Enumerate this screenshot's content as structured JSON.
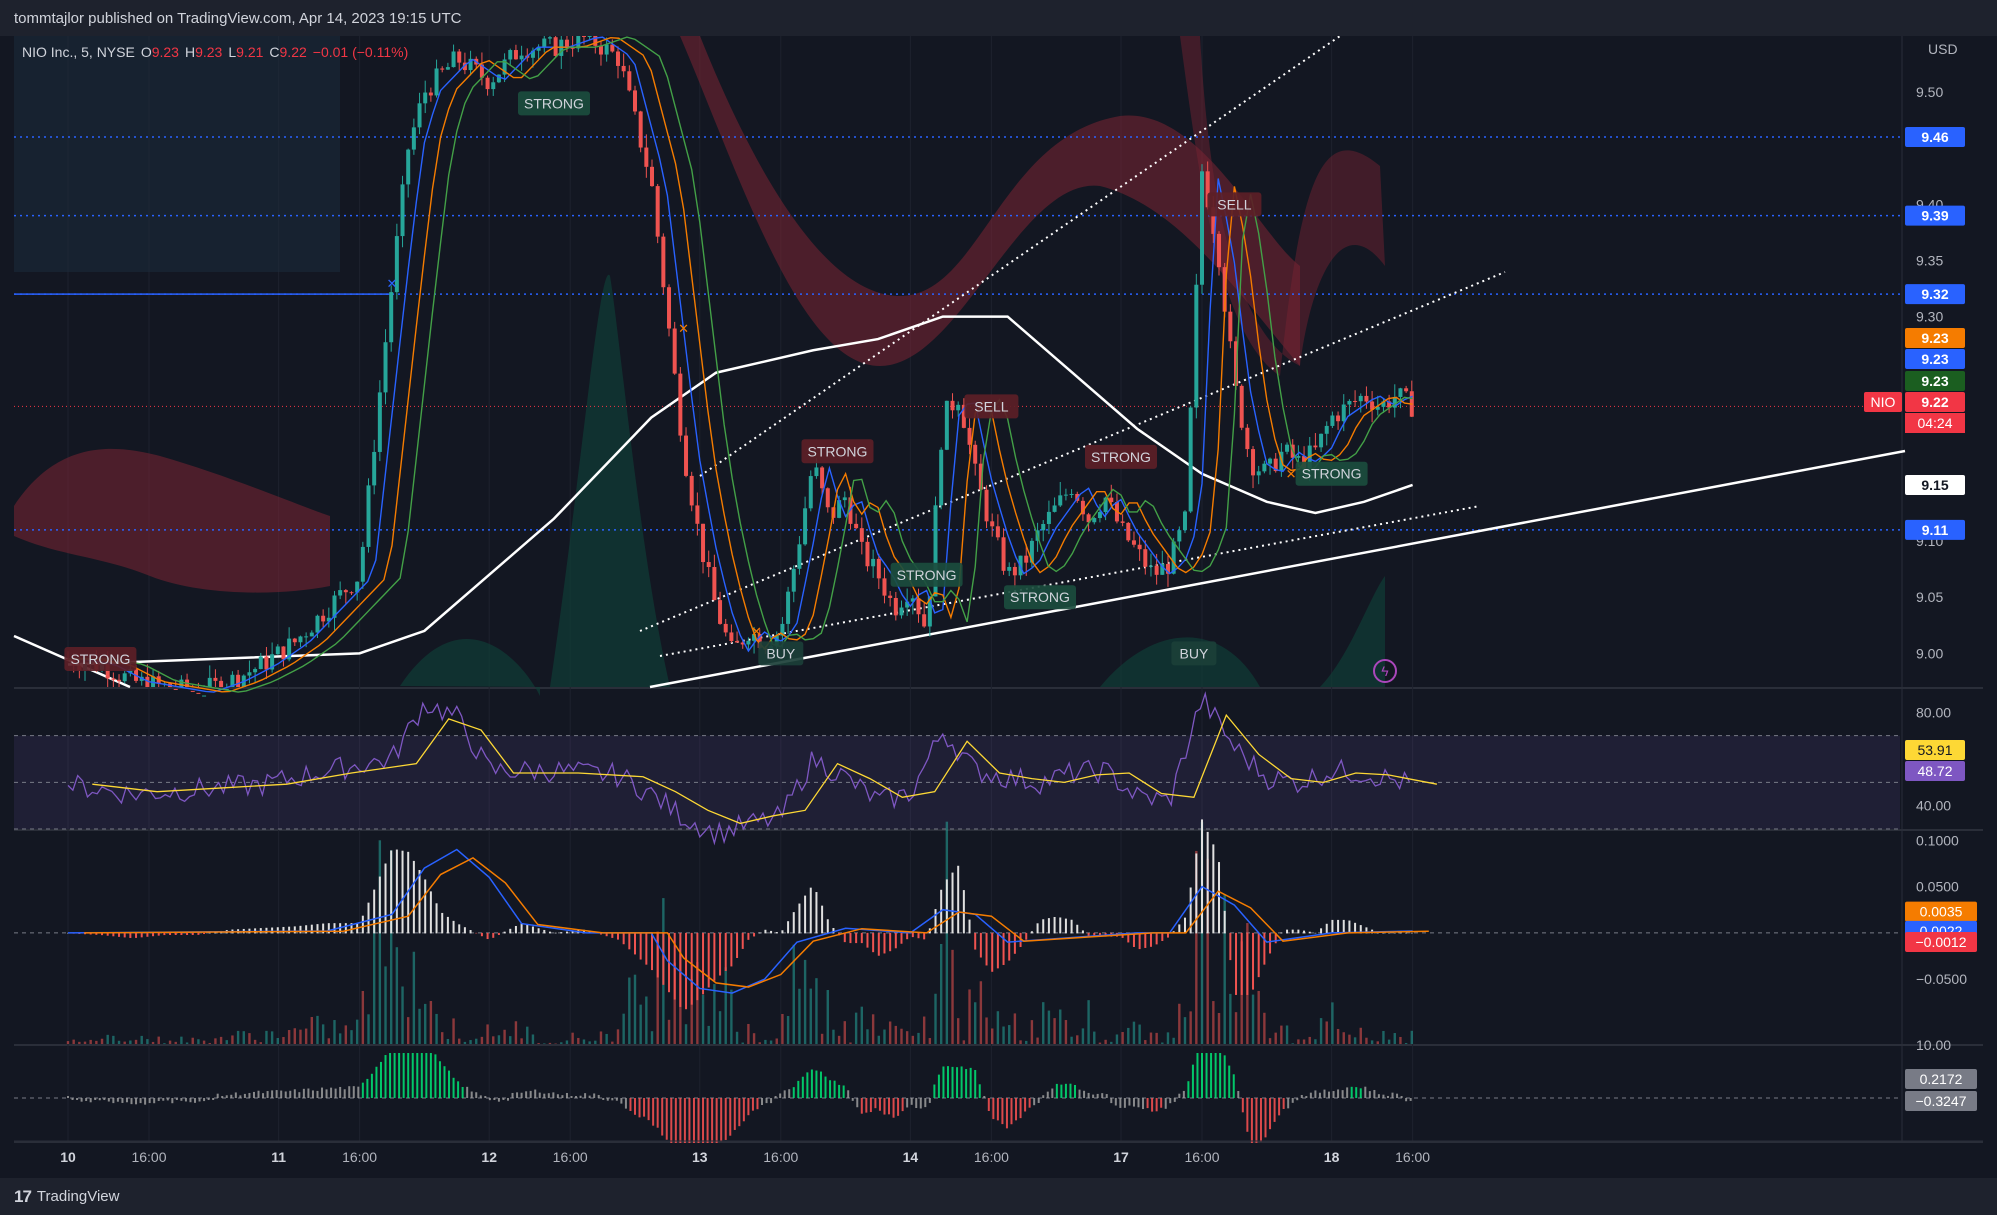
{
  "header": {
    "published": "tommtajlor published on TradingView.com, Apr 14, 2023 19:15 UTC"
  },
  "footer": {
    "brand": "TradingView"
  },
  "legend": {
    "symbol": "NIO Inc., 5, NYSE",
    "o_label": "O",
    "o": "9.23",
    "h_label": "H",
    "h": "9.23",
    "l_label": "L",
    "l": "9.21",
    "c_label": "C",
    "c": "9.22",
    "chg": "−0.01 (−0.11%)"
  },
  "colors": {
    "background": "#131722",
    "up": "#26a69a",
    "down": "#ef5350",
    "hline": "#2962ff",
    "accent_red": "#f23645"
  },
  "chart_data": [
    {
      "type": "line",
      "name": "price",
      "currency_label": "USD",
      "y_ticks": [
        "9.50",
        "9.40",
        "9.35",
        "9.30",
        "9.10",
        "9.05",
        "9.00"
      ],
      "x_ticks": [
        "10",
        "16:00",
        "11",
        "16:00",
        "12",
        "16:00",
        "13",
        "16:00",
        "14",
        "16:00",
        "17",
        "16:00",
        "18",
        "16:00"
      ],
      "ylim": [
        8.97,
        9.55
      ],
      "close_path": [
        [
          0,
          8.995
        ],
        [
          2,
          8.99
        ],
        [
          4,
          8.975
        ],
        [
          6,
          8.97
        ],
        [
          8,
          8.965
        ],
        [
          10,
          8.975
        ],
        [
          12,
          8.99
        ],
        [
          14,
          9.01
        ],
        [
          16,
          9.04
        ],
        [
          18,
          9.07
        ],
        [
          20,
          9.33
        ],
        [
          21,
          9.45
        ],
        [
          22,
          9.5
        ],
        [
          24,
          9.53
        ],
        [
          26,
          9.51
        ],
        [
          28,
          9.54
        ],
        [
          30,
          9.54
        ],
        [
          32,
          9.55
        ],
        [
          34,
          9.53
        ],
        [
          36,
          9.42
        ],
        [
          37,
          9.3
        ],
        [
          38,
          9.18
        ],
        [
          39,
          9.1
        ],
        [
          40,
          9.04
        ],
        [
          41,
          9.0
        ],
        [
          42,
          9.02
        ],
        [
          43,
          9.01
        ],
        [
          44,
          9.02
        ],
        [
          45,
          9.09
        ],
        [
          46,
          9.17
        ],
        [
          47,
          9.12
        ],
        [
          48,
          9.14
        ],
        [
          49,
          9.09
        ],
        [
          50,
          9.07
        ],
        [
          51,
          9.04
        ],
        [
          52,
          9.06
        ],
        [
          53,
          9.02
        ],
        [
          54,
          9.21
        ],
        [
          55,
          9.23
        ],
        [
          56,
          9.16
        ],
        [
          57,
          9.11
        ],
        [
          58,
          9.07
        ],
        [
          59,
          9.08
        ],
        [
          60,
          9.11
        ],
        [
          61,
          9.13
        ],
        [
          62,
          9.15
        ],
        [
          63,
          9.12
        ],
        [
          64,
          9.14
        ],
        [
          65,
          9.11
        ],
        [
          66,
          9.09
        ],
        [
          67,
          9.07
        ],
        [
          68,
          9.08
        ],
        [
          69,
          9.12
        ],
        [
          70,
          9.43
        ],
        [
          71,
          9.36
        ],
        [
          72,
          9.24
        ],
        [
          73,
          9.17
        ],
        [
          74,
          9.16
        ],
        [
          75,
          9.18
        ],
        [
          76,
          9.17
        ],
        [
          77,
          9.18
        ],
        [
          78,
          9.21
        ],
        [
          79,
          9.22
        ],
        [
          80,
          9.23
        ],
        [
          81,
          9.22
        ],
        [
          82,
          9.23
        ],
        [
          83,
          9.22
        ]
      ],
      "ma_white": [
        [
          0,
          8.99
        ],
        [
          18,
          9.0
        ],
        [
          22,
          9.02
        ],
        [
          30,
          9.12
        ],
        [
          36,
          9.21
        ],
        [
          40,
          9.25
        ],
        [
          46,
          9.27
        ],
        [
          50,
          9.28
        ],
        [
          54,
          9.3
        ],
        [
          58,
          9.3
        ],
        [
          62,
          9.25
        ],
        [
          66,
          9.2
        ],
        [
          70,
          9.16
        ],
        [
          74,
          9.135
        ],
        [
          77,
          9.125
        ],
        [
          80,
          9.135
        ],
        [
          83,
          9.15
        ]
      ],
      "horizontal_levels": [
        {
          "value": 9.46,
          "label": "9.46",
          "color": "#2962ff"
        },
        {
          "value": 9.39,
          "label": "9.39",
          "color": "#2962ff"
        },
        {
          "value": 9.32,
          "label": "9.32",
          "color": "#2962ff"
        },
        {
          "value": 9.11,
          "label": "9.11",
          "color": "#2962ff"
        }
      ],
      "price_labels": [
        {
          "value": 9.23,
          "label": "9.23",
          "color": "#f57c00"
        },
        {
          "value": 9.23,
          "label": "9.23",
          "color": "#2962ff"
        },
        {
          "value": 9.23,
          "label": "9.23",
          "color": "#1b5e20"
        },
        {
          "value": 9.22,
          "label": "9.22",
          "color": "#f23645",
          "tag": "NIO",
          "time": "04:24"
        },
        {
          "value": 9.15,
          "label": "9.15",
          "color": "#ffffff"
        }
      ],
      "signals": [
        {
          "x": 2,
          "y": 8.995,
          "label": "STRONG",
          "kind": "strong-red"
        },
        {
          "x": 30,
          "y": 9.49,
          "label": "STRONG",
          "kind": "strong-green"
        },
        {
          "x": 44,
          "y": 9.0,
          "label": "BUY",
          "kind": "buy"
        },
        {
          "x": 47.5,
          "y": 9.18,
          "label": "STRONG",
          "kind": "strong-red"
        },
        {
          "x": 53,
          "y": 9.07,
          "label": "STRONG",
          "kind": "strong-green"
        },
        {
          "x": 57,
          "y": 9.22,
          "label": "SELL",
          "kind": "sell"
        },
        {
          "x": 60,
          "y": 9.05,
          "label": "STRONG",
          "kind": "strong-green"
        },
        {
          "x": 65,
          "y": 9.175,
          "label": "STRONG",
          "kind": "strong-red"
        },
        {
          "x": 69.5,
          "y": 9.0,
          "label": "BUY",
          "kind": "buy"
        },
        {
          "x": 72,
          "y": 9.4,
          "label": "SELL",
          "kind": "sell"
        },
        {
          "x": 78,
          "y": 9.16,
          "label": "STRONG",
          "kind": "strong-green"
        }
      ]
    },
    {
      "type": "line",
      "name": "RSI",
      "y_ticks": [
        "80.00",
        "40.00"
      ],
      "ylim": [
        30,
        90
      ],
      "values_label_1": "53.91",
      "values_label_2": "48.72",
      "path": [
        [
          0,
          49
        ],
        [
          4,
          45
        ],
        [
          8,
          47
        ],
        [
          12,
          49
        ],
        [
          16,
          55
        ],
        [
          20,
          60
        ],
        [
          22,
          84
        ],
        [
          24,
          78
        ],
        [
          26,
          55
        ],
        [
          30,
          55
        ],
        [
          34,
          53
        ],
        [
          36,
          45
        ],
        [
          38,
          35
        ],
        [
          40,
          28
        ],
        [
          42,
          32
        ],
        [
          44,
          35
        ],
        [
          46,
          60
        ],
        [
          48,
          52
        ],
        [
          50,
          42
        ],
        [
          52,
          45
        ],
        [
          54,
          72
        ],
        [
          56,
          55
        ],
        [
          58,
          52
        ],
        [
          60,
          50
        ],
        [
          62,
          54
        ],
        [
          64,
          55
        ],
        [
          66,
          44
        ],
        [
          68,
          42
        ],
        [
          70,
          86
        ],
        [
          72,
          65
        ],
        [
          74,
          52
        ],
        [
          76,
          50
        ],
        [
          78,
          55
        ],
        [
          80,
          54
        ],
        [
          83,
          49
        ]
      ]
    },
    {
      "type": "bar",
      "name": "MACD",
      "y_ticks": [
        "0.1000",
        "0.0500",
        "−0.0500"
      ],
      "ylim": [
        -0.12,
        0.11
      ],
      "values_label_1": "0.0035",
      "values_label_2": "0.0022",
      "values_label_3": "−0.0012",
      "macd_path": [
        [
          0,
          0
        ],
        [
          16,
          0.002
        ],
        [
          20,
          0.02
        ],
        [
          22,
          0.07
        ],
        [
          24,
          0.09
        ],
        [
          26,
          0.06
        ],
        [
          28,
          0.01
        ],
        [
          32,
          0.0
        ],
        [
          36,
          0.0
        ],
        [
          37,
          -0.03
        ],
        [
          39,
          -0.06
        ],
        [
          41,
          -0.065
        ],
        [
          43,
          -0.05
        ],
        [
          45,
          -0.01
        ],
        [
          48,
          0.005
        ],
        [
          52,
          0.0
        ],
        [
          54,
          0.025
        ],
        [
          56,
          0.02
        ],
        [
          58,
          -0.01
        ],
        [
          62,
          -0.005
        ],
        [
          66,
          0.0
        ],
        [
          68,
          0.0
        ],
        [
          70,
          0.05
        ],
        [
          72,
          0.03
        ],
        [
          74,
          -0.01
        ],
        [
          78,
          0.0
        ],
        [
          83,
          0.002
        ]
      ]
    },
    {
      "type": "bar",
      "name": "oscillator",
      "values_label_1": "0.2172",
      "values_label_2": "−0.3247"
    }
  ]
}
